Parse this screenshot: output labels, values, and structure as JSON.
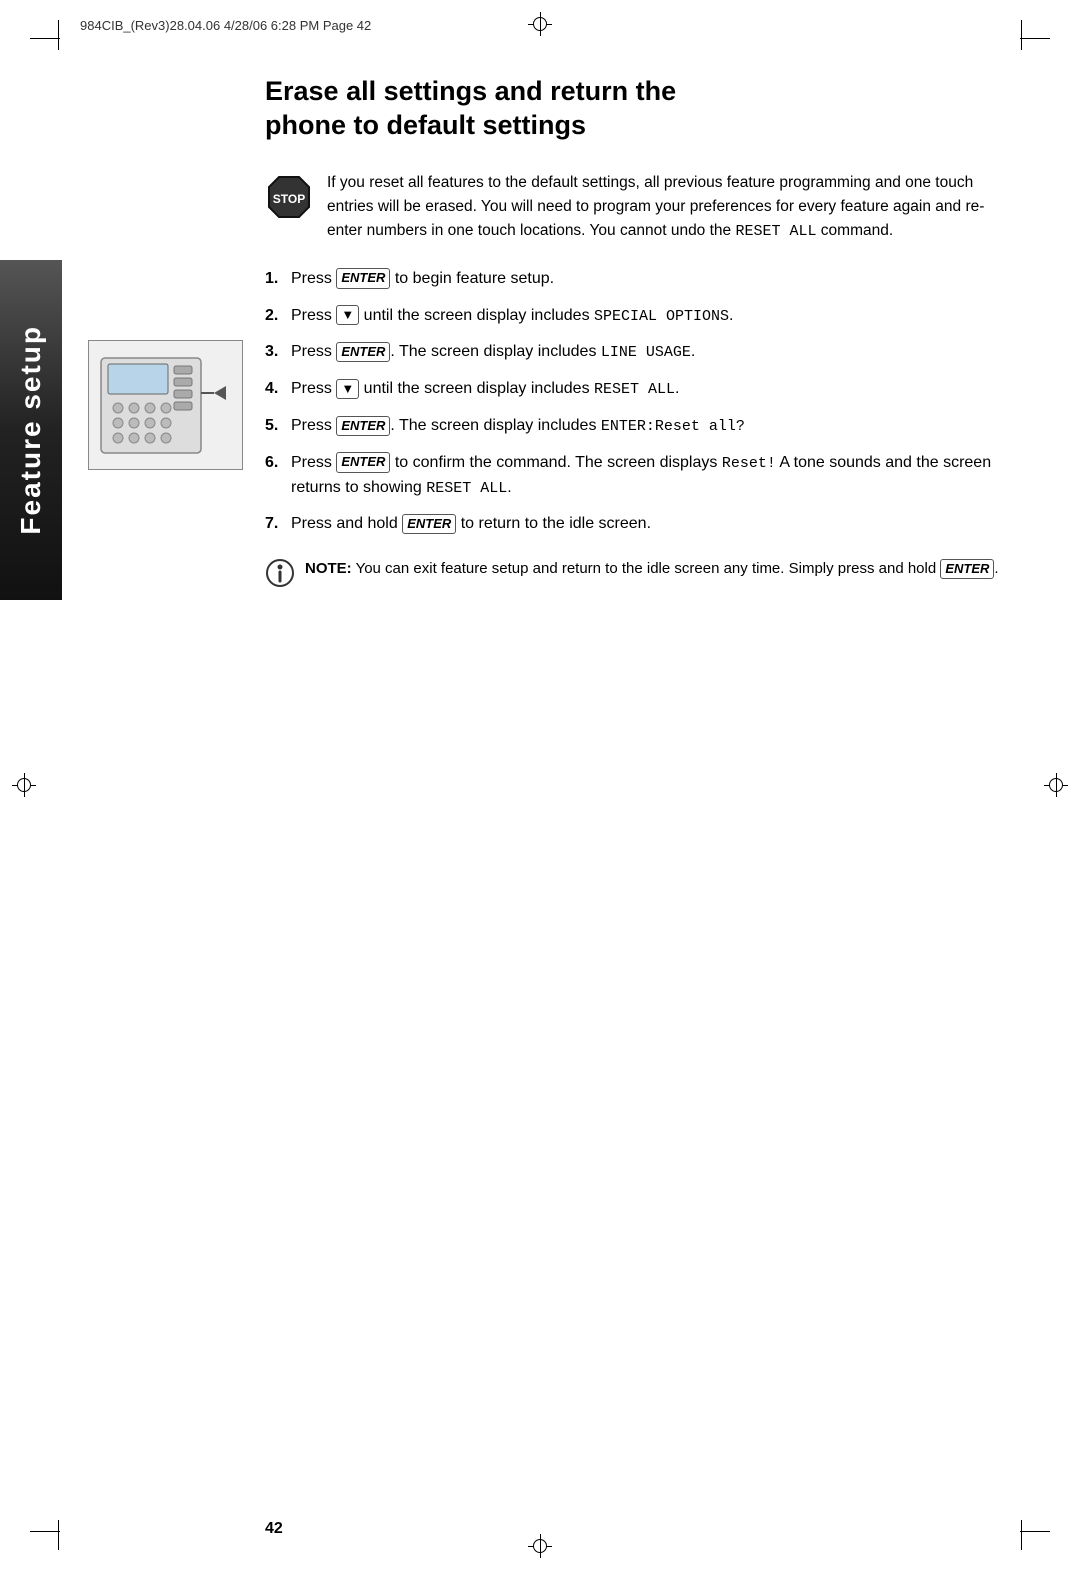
{
  "header": {
    "print_info": "984CIB_(Rev3)28.04.06  4/28/06  6:28 PM  Page 42"
  },
  "sidebar": {
    "tab_label": "Feature setup"
  },
  "title": {
    "line1": "Erase all settings and return the",
    "line2": "phone to default settings"
  },
  "warning": {
    "text": "If you reset all features to the default settings, all previous feature programming and one touch entries will be erased. You will need to program your preferences for every feature again and re-enter numbers in one touch locations. You cannot undo the ",
    "command": "RESET ALL",
    "text_end": " command."
  },
  "steps": [
    {
      "num": "1.",
      "text_before": "Press ",
      "key": "ENTER",
      "text_after": " to begin feature setup."
    },
    {
      "num": "2.",
      "text_before": "Press ",
      "key": "▼",
      "text_after": " until the screen display includes ",
      "mono": "SPECIAL OPTIONS",
      "text_end": "."
    },
    {
      "num": "3.",
      "text_before": "Press ",
      "key": "ENTER",
      "text_after": ". The screen display includes ",
      "mono": "LINE USAGE",
      "text_end": "."
    },
    {
      "num": "4.",
      "text_before": "Press ",
      "key": "▼",
      "text_after": " until the screen display includes ",
      "mono": "RESET ALL",
      "text_end": "."
    },
    {
      "num": "5.",
      "text_before": "Press ",
      "key": "ENTER",
      "text_after": ". The screen display includes ",
      "mono": "ENTER:Reset all?",
      "text_end": ""
    },
    {
      "num": "6.",
      "text_before": "Press ",
      "key": "ENTER",
      "text_after": " to confirm the command. The screen displays ",
      "mono": "Reset!",
      "text_after2": " A tone sounds and the screen returns to showing ",
      "mono2": "RESET ALL",
      "text_end": "."
    },
    {
      "num": "7.",
      "text_before": "Press and hold ",
      "key": "ENTER",
      "text_after": " to return to the idle screen."
    }
  ],
  "note": {
    "label": "NOTE:",
    "text": " You can exit feature setup and return to the idle screen any time.  Simply press and hold ",
    "key": "ENTER",
    "text_end": "."
  },
  "page_number": "42"
}
